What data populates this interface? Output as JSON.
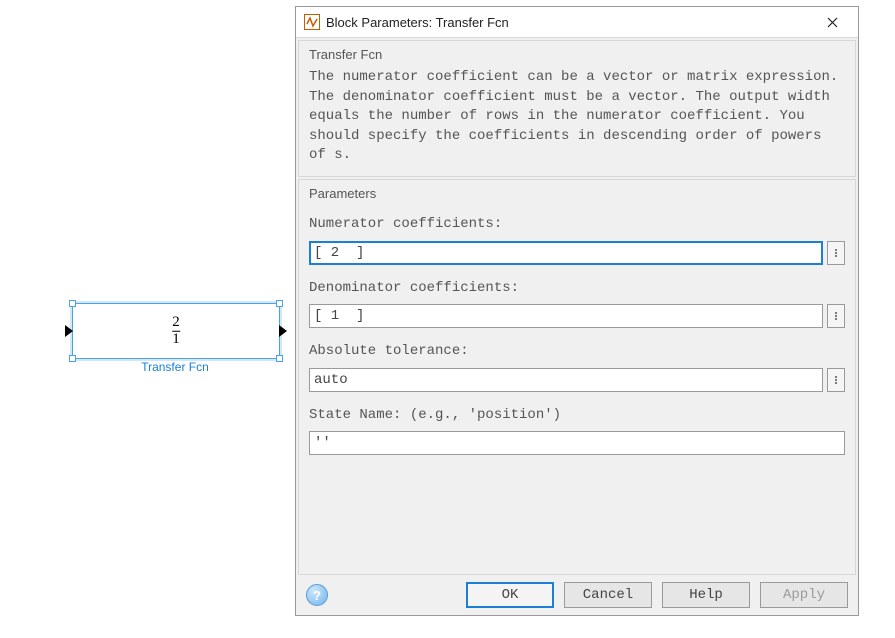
{
  "block": {
    "numerator_display": "2",
    "denominator_display": "1",
    "label": "Transfer Fcn"
  },
  "dialog": {
    "title": "Block Parameters: Transfer Fcn",
    "group": {
      "legend": "Transfer Fcn",
      "description": "The numerator coefficient can be a vector or matrix expression. The denominator coefficient must be a vector. The output width equals the number of rows in the numerator coefficient. You should specify the coefficients in descending order of powers of s."
    },
    "parameters": {
      "legend": "Parameters",
      "fields": {
        "numerator": {
          "label": "Numerator coefficients:",
          "value": "[ 2  ]"
        },
        "denominator": {
          "label": "Denominator coefficients:",
          "value": "[ 1  ]"
        },
        "abstol": {
          "label": "Absolute tolerance:",
          "value": "auto"
        },
        "statename": {
          "label": "State Name: (e.g., 'position')",
          "value": "''"
        }
      }
    },
    "buttons": {
      "ok": "OK",
      "cancel": "Cancel",
      "help": "Help",
      "apply": "Apply"
    }
  }
}
